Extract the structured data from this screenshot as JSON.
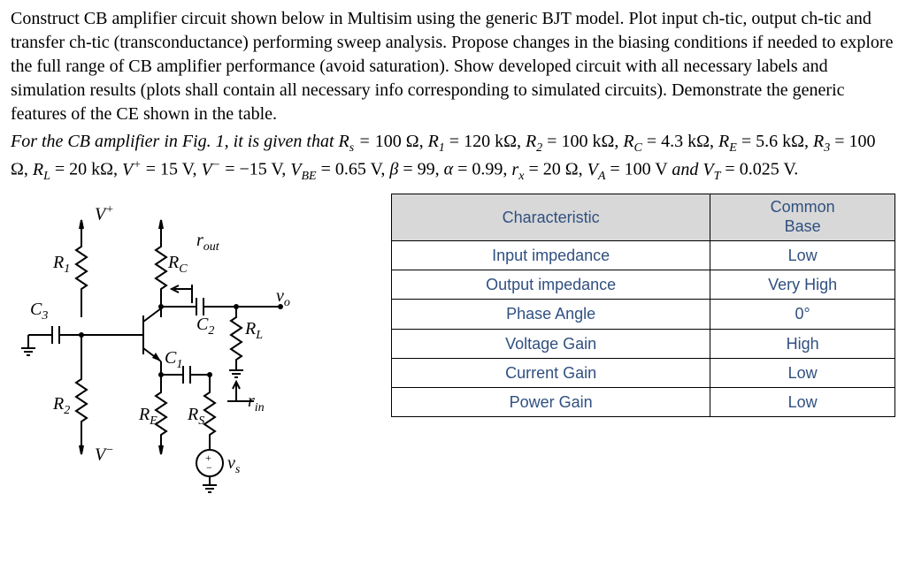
{
  "paragraph1": "Construct CB amplifier circuit shown below in Multisim using the generic BJT model. Plot input ch-tic, output ch-tic and transfer ch-tic (transconductance) performing sweep analysis. Propose changes in the biasing conditions if needed to explore the full range of CB amplifier performance (avoid saturation). Show developed circuit with all necessary labels and simulation results (plots shall contain all necessary info corresponding to simulated circuits). Demonstrate the generic features of the CE shown in the table.",
  "given_intro": "For the CB amplifier in Fig. 1, it is given that R",
  "given_values": {
    "Rs": "100 Ω",
    "R1": "120 kΩ",
    "R2": "100 kΩ",
    "RC": "4.3 kΩ",
    "RE": "5.6 kΩ",
    "R3": "100 Ω",
    "RL": "20 kΩ",
    "Vplus": "15 V",
    "Vminus": "−15 V",
    "VBE": "0.65 V",
    "beta": "99",
    "alpha": "0.99",
    "rx": "20 Ω",
    "VA": "100 V",
    "VT": "0.025 V"
  },
  "circuit_labels": {
    "Vplus": "V",
    "Vminus": "V",
    "R1": "R",
    "R2": "R",
    "RC": "R",
    "RE": "R",
    "RL": "R",
    "RS": "R",
    "C1": "C",
    "C2": "C",
    "C3": "C",
    "rout": "r",
    "rin": "r",
    "vo": "v",
    "vs": "v"
  },
  "circuit_subs": {
    "R1": "1",
    "R2": "2",
    "RC": "C",
    "RE": "E",
    "RL": "L",
    "RS": "S",
    "C1": "1",
    "C2": "2",
    "C3": "3",
    "rout": "out",
    "rin": "in",
    "vo": "o",
    "vs": "s"
  },
  "table": {
    "headers": [
      "Characteristic",
      "Common Base"
    ],
    "rows": [
      [
        "Input impedance",
        "Low"
      ],
      [
        "Output impedance",
        "Very High"
      ],
      [
        "Phase Angle",
        "0°"
      ],
      [
        "Voltage Gain",
        "High"
      ],
      [
        "Current Gain",
        "Low"
      ],
      [
        "Power Gain",
        "Low"
      ]
    ]
  }
}
